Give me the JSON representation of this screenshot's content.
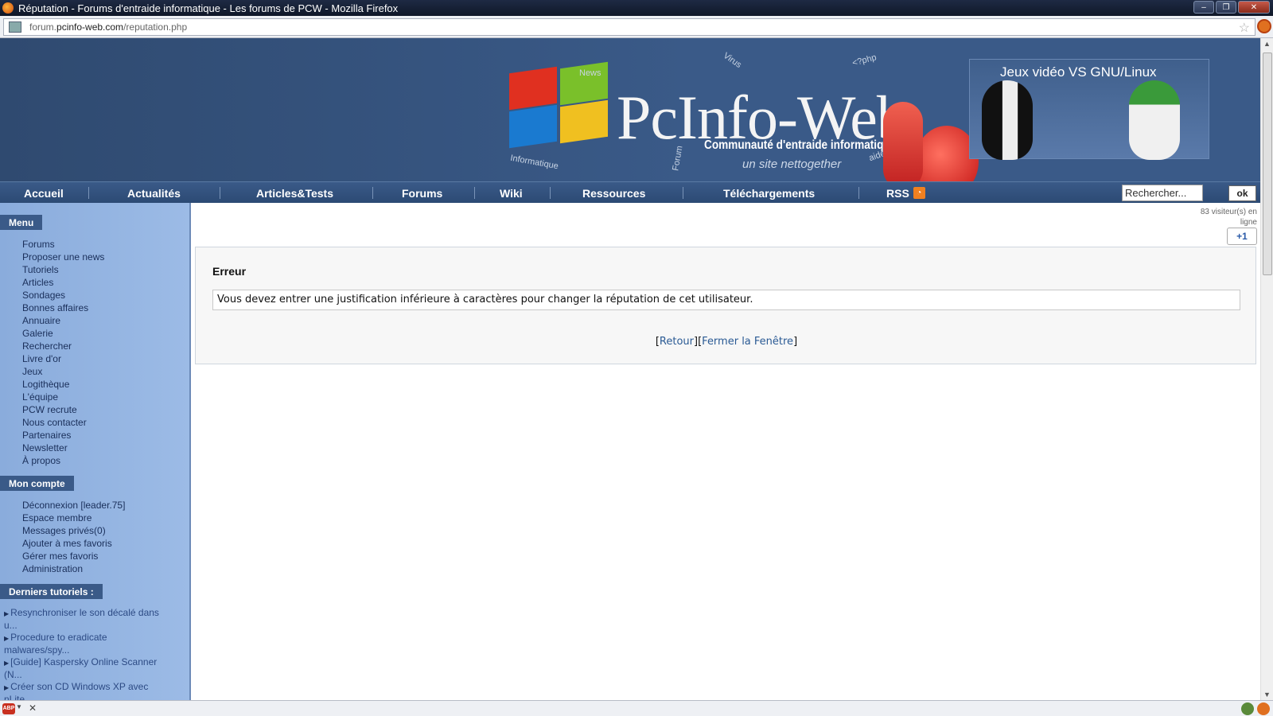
{
  "window": {
    "title": "Réputation - Forums d'entraide informatique - Les forums de PCW - Mozilla Firefox"
  },
  "urlbar": {
    "domain_prefix": "forum.",
    "domain": "pcinfo-web.com",
    "path": "/reputation.php"
  },
  "banner": {
    "logo": "PcInfo-Web",
    "subtitle": "Communauté d'entraide informatique",
    "tagline": "un site nettogether",
    "promo_title": "Jeux vidéo VS GNU/Linux",
    "deco_words": [
      "News",
      "Virus",
      "<?php",
      "Informatique",
      "Forum",
      "aide"
    ]
  },
  "nav": {
    "items": [
      "Accueil",
      "Actualités",
      "Articles&Tests",
      "Forums",
      "Wiki",
      "Ressources",
      "Téléchargements",
      "RSS"
    ],
    "search_value": "Rechercher...",
    "search_button": "ok"
  },
  "sidebar": {
    "menu_heading": "Menu",
    "menu_items": [
      "Forums",
      "Proposer une news",
      "Tutoriels",
      "Articles",
      "Sondages",
      "Bonnes affaires",
      "Annuaire",
      "Galerie",
      "Rechercher",
      "Livre d'or",
      "Jeux",
      "Logithèque",
      "L'équipe",
      "PCW recrute",
      "Nous contacter",
      "Partenaires",
      "Newsletter",
      "À propos"
    ],
    "account_heading": "Mon compte",
    "account_items": [
      "Déconnexion [leader.75]",
      "Espace membre",
      "Messages privés(0)",
      "Ajouter à mes favoris",
      "Gérer mes favoris",
      "Administration"
    ],
    "tutorials_heading": "Derniers tutoriels :",
    "tutorials": [
      "Resynchroniser le son décalé dans u...",
      "Procedure to eradicate malwares/spy...",
      "[Guide] Kaspersky Online Scanner (N...",
      "Créer son CD Windows XP avec nLite..."
    ]
  },
  "main": {
    "visitors": "83 visiteur(s) en ligne",
    "plusone": "+1",
    "error_title": "Erreur",
    "error_message": "Vous devez entrer une justification inférieure à caractères pour changer la réputation de cet utilisateur.",
    "link_back": "Retour",
    "link_close": "Fermer la Fenêtre"
  },
  "colors": {
    "header_blue": "#3a5a88",
    "sidebar_blue": "#9cbbe6",
    "link_blue": "#2a5a94"
  }
}
